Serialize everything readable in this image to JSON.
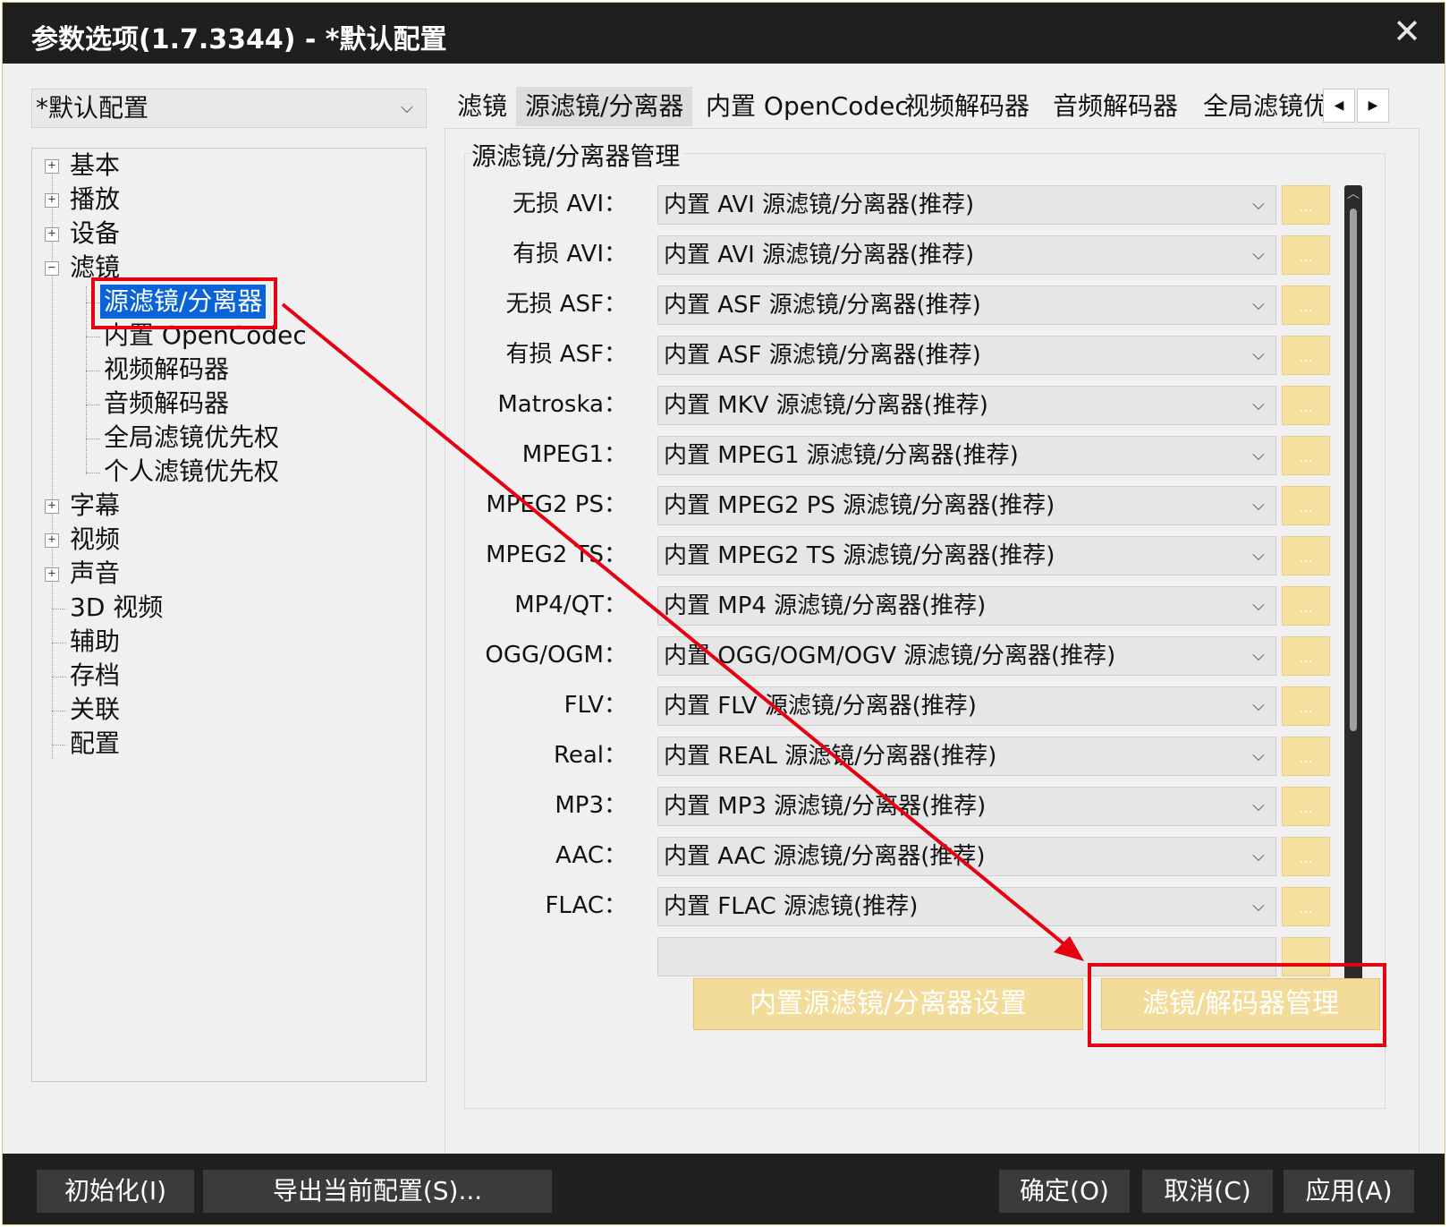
{
  "window": {
    "title": "参数选项(1.7.3344) - *默认配置",
    "close_glyph": "✕"
  },
  "profile_select": {
    "value": "*默认配置"
  },
  "tree": {
    "items": [
      {
        "label": "基本",
        "expander": "+"
      },
      {
        "label": "播放",
        "expander": "+"
      },
      {
        "label": "设备",
        "expander": "+"
      },
      {
        "label": "滤镜",
        "expander": "−"
      },
      {
        "label": "源滤镜/分离器"
      },
      {
        "label": "内置 OpenCodec"
      },
      {
        "label": "视频解码器"
      },
      {
        "label": "音频解码器"
      },
      {
        "label": "全局滤镜优先权"
      },
      {
        "label": "个人滤镜优先权"
      },
      {
        "label": "字幕",
        "expander": "+"
      },
      {
        "label": "视频",
        "expander": "+"
      },
      {
        "label": "声音",
        "expander": "+"
      },
      {
        "label": "3D 视频"
      },
      {
        "label": "辅助"
      },
      {
        "label": "存档"
      },
      {
        "label": "关联"
      },
      {
        "label": "配置"
      }
    ]
  },
  "tabs": [
    {
      "label": "滤镜"
    },
    {
      "label": "源滤镜/分离器"
    },
    {
      "label": "内置 OpenCodec"
    },
    {
      "label": "视频解码器"
    },
    {
      "label": "音频解码器"
    },
    {
      "label": "全局滤镜优"
    }
  ],
  "tab_arrows": {
    "left": "◀",
    "right": "▶"
  },
  "group": {
    "title": "源滤镜/分离器管理",
    "more_label": "...",
    "rows": [
      {
        "label": "无损 AVI：",
        "value": "内置 AVI 源滤镜/分离器(推荐)"
      },
      {
        "label": "有损 AVI：",
        "value": "内置 AVI 源滤镜/分离器(推荐)"
      },
      {
        "label": "无损 ASF：",
        "value": "内置 ASF 源滤镜/分离器(推荐)"
      },
      {
        "label": "有损 ASF：",
        "value": "内置 ASF 源滤镜/分离器(推荐)"
      },
      {
        "label": "Matroska：",
        "value": "内置 MKV 源滤镜/分离器(推荐)"
      },
      {
        "label": "MPEG1：",
        "value": "内置 MPEG1 源滤镜/分离器(推荐)"
      },
      {
        "label": "MPEG2 PS：",
        "value": "内置 MPEG2 PS 源滤镜/分离器(推荐)"
      },
      {
        "label": "MPEG2 TS：",
        "value": "内置 MPEG2 TS 源滤镜/分离器(推荐)"
      },
      {
        "label": "MP4/QT：",
        "value": "内置 MP4 源滤镜/分离器(推荐)"
      },
      {
        "label": "OGG/OGM：",
        "value": "内置 OGG/OGM/OGV 源滤镜/分离器(推荐)"
      },
      {
        "label": "FLV：",
        "value": "内置 FLV 源滤镜/分离器(推荐)"
      },
      {
        "label": "Real：",
        "value": "内置 REAL 源滤镜/分离器(推荐)"
      },
      {
        "label": "MP3：",
        "value": "内置 MP3 源滤镜/分离器(推荐)"
      },
      {
        "label": "AAC：",
        "value": "内置 AAC 源滤镜/分离器(推荐)"
      },
      {
        "label": "FLAC：",
        "value": "内置 FLAC 源滤镜(推荐)"
      }
    ]
  },
  "actions": {
    "builtin_settings": "内置源滤镜/分离器设置",
    "filter_manager": "滤镜/解码器管理"
  },
  "footer": {
    "init": "初始化(I)",
    "export": "导出当前配置(S)...",
    "ok": "确定(O)",
    "cancel": "取消(C)",
    "apply": "应用(A)"
  },
  "annotation_color": "#e60012"
}
